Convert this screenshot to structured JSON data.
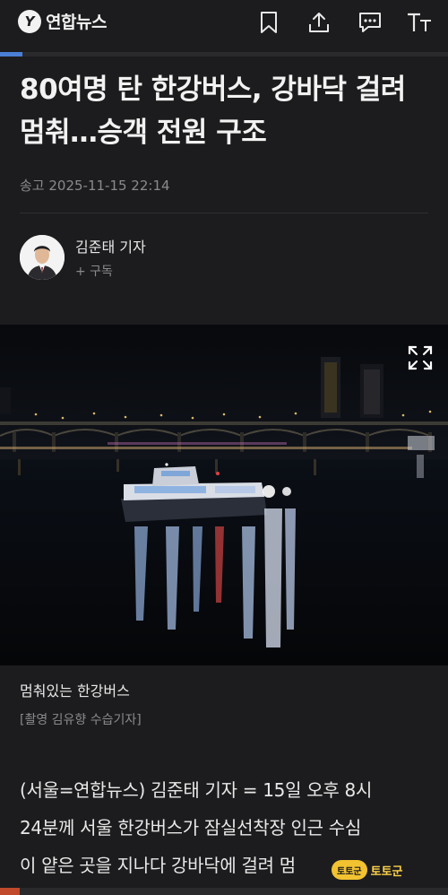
{
  "app": {
    "logo_mark": "Y",
    "logo_text": "연합뉴스",
    "progress_fraction": 0.05
  },
  "toolbar": {
    "icons": [
      "bookmark-icon",
      "share-icon",
      "comment-icon",
      "font-size-icon"
    ]
  },
  "article": {
    "headline_line1": "80여명 탄 한강버스, 강바닥 걸려",
    "headline_line2": "멈춰…승객 전원 구조",
    "dateline": "송고 2025-11-15 22:14",
    "reporter": {
      "name": "김준태 기자",
      "subscribe": "+ 구독"
    },
    "photo": {
      "caption": "멈춰있는 한강버스",
      "credit": "[촬영 김유향 수습기자]"
    },
    "body_line1": "(서울=연합뉴스) 김준태 기자 = 15일 오후 8시",
    "body_line2": "24분께 서울 한강버스가 잠실선착장 인근 수심",
    "body_line3": "이 얕은 곳을 지나다 강바닥에 걸려 멈"
  },
  "watermark": {
    "badge": "토토군",
    "text": "토토군"
  },
  "colors": {
    "background": "#1c1c1e",
    "accent": "#4a7fd6",
    "muted_text": "#8a8a8e"
  }
}
